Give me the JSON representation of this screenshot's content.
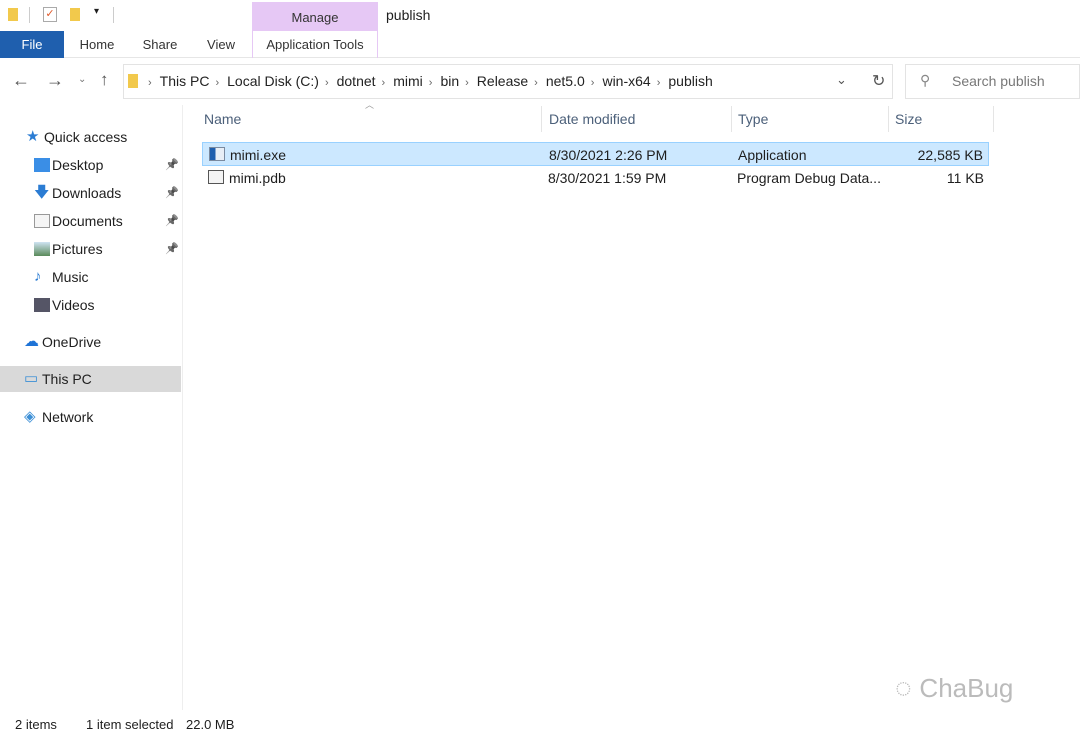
{
  "window": {
    "title": "publish"
  },
  "ribbon": {
    "contextual_group": "Manage",
    "tabs": [
      "File",
      "Home",
      "Share",
      "View",
      "Application Tools"
    ]
  },
  "address": {
    "segments": [
      "This PC",
      "Local Disk (C:)",
      "dotnet",
      "mimi",
      "bin",
      "Release",
      "net5.0",
      "win-x64",
      "publish"
    ]
  },
  "search": {
    "placeholder": "Search publish"
  },
  "sidebar": {
    "items": [
      {
        "label": "Quick access",
        "icon": "star-icon"
      },
      {
        "label": "Desktop",
        "icon": "desktop-icon",
        "pinned": true
      },
      {
        "label": "Downloads",
        "icon": "download-icon",
        "pinned": true
      },
      {
        "label": "Documents",
        "icon": "documents-icon",
        "pinned": true
      },
      {
        "label": "Pictures",
        "icon": "pictures-icon",
        "pinned": true
      },
      {
        "label": "Music",
        "icon": "music-icon"
      },
      {
        "label": "Videos",
        "icon": "videos-icon"
      },
      {
        "label": "OneDrive",
        "icon": "cloud-icon"
      },
      {
        "label": "This PC",
        "icon": "computer-icon",
        "selected": true
      },
      {
        "label": "Network",
        "icon": "network-icon"
      }
    ]
  },
  "columns": [
    "Name",
    "Date modified",
    "Type",
    "Size"
  ],
  "files": [
    {
      "name": "mimi.exe",
      "date": "8/30/2021 2:26 PM",
      "type": "Application",
      "size": "22,585 KB",
      "selected": true
    },
    {
      "name": "mimi.pdb",
      "date": "8/30/2021 1:59 PM",
      "type": "Program Debug Data...",
      "size": "11 KB"
    }
  ],
  "status": {
    "count": "2 items",
    "selection": "1 item selected",
    "size": "22.0 MB"
  },
  "watermark": "ChaBug",
  "colors": {
    "accent": "#1f5fae",
    "selection": "#cce8ff",
    "manage": "#e6c8f5"
  }
}
